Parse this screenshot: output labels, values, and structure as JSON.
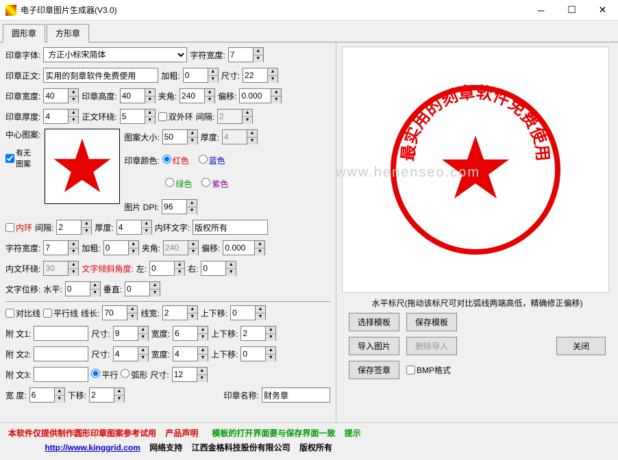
{
  "title": "电子印章图片生成器(V3.0)",
  "tabs": {
    "round": "圆形章",
    "square": "方形章"
  },
  "font": {
    "label": "印章字体:",
    "value": "方正小标宋简体",
    "charwidth_label": "字符宽度:",
    "charwidth": "7"
  },
  "text": {
    "label": "印章正文:",
    "value": "实用的刻章软件免费使用",
    "bold_label": "加粗:",
    "bold": "0",
    "size_label": "尺寸:",
    "size": "22"
  },
  "dims": {
    "width_label": "印章宽度:",
    "width": "40",
    "height_label": "印章高度:",
    "height": "40",
    "angle_label": "夹角:",
    "angle": "240",
    "offset_label": "偏移:",
    "offset": "0.000"
  },
  "thick": {
    "label": "印章厚度:",
    "value": "4",
    "wrap_label": "正文环绕:",
    "wrap": "5",
    "dbl_outer": "双外环",
    "gap_label": "间隔:",
    "gap": "2"
  },
  "center": {
    "label": "中心图案:",
    "has_img": "有无\n图案",
    "pattern_size_label": "图案大小:",
    "pattern_size": "50",
    "thick_label": "厚度:",
    "thick": "4",
    "color_label": "印章颜色:",
    "red": "红色",
    "blue": "蓝色",
    "green": "绿色",
    "purple": "紫色",
    "dpi_label": "图片 DPI:",
    "dpi": "96"
  },
  "inner": {
    "ring": "内环",
    "gap_label": "间隔:",
    "gap": "2",
    "thick_label": "厚度:",
    "thick": "4",
    "text_label": "内环文字:",
    "text": "版权所有"
  },
  "inner_font": {
    "width_label": "字符宽度:",
    "width": "7",
    "bold_label": "加粗:",
    "bold": "0",
    "angle_label": "夹角:",
    "angle": "240",
    "offset_label": "偏移:",
    "offset": "0.000"
  },
  "inner_wrap": {
    "label": "内文环绕:",
    "value": "30",
    "tilt_label": "文字倾斜角度:",
    "left_label": "左:",
    "left": "0",
    "right_label": "右:",
    "right": "0"
  },
  "text_shift": {
    "label": "文字位移:",
    "h_label": "水平:",
    "h": "0",
    "v_label": "垂直:",
    "v": "0"
  },
  "lines": {
    "contrast": "对比线",
    "parallel": "平行线",
    "len_label": "线长:",
    "len": "70",
    "width_label": "线宽:",
    "width": "2",
    "updown_label": "上下移:",
    "updown": "0"
  },
  "att1": {
    "label": "附  文1:",
    "value": "",
    "size_label": "尺寸:",
    "size": "9",
    "width_label": "宽度:",
    "width": "6",
    "updown_label": "上下移:",
    "updown": "2"
  },
  "att2": {
    "label": "附  文2:",
    "value": "",
    "size_label": "尺寸:",
    "size": "4",
    "width_label": "宽度:",
    "width": "4",
    "updown_label": "上下移:",
    "updown": "0"
  },
  "att3": {
    "label": "附  文3:",
    "value": "",
    "parallel": "平行",
    "arc": "弧形",
    "size_label": "尺寸:",
    "size": "12"
  },
  "bottom": {
    "width_label": "宽    度:",
    "width": "6",
    "down_label": "下移:",
    "down": "2",
    "name_label": "印章名称:",
    "name": "财务章"
  },
  "ruler_hint": "水平标尺(拖动该标尺可对比弧线两端高低，精确修正偏移)",
  "btns": {
    "choose_tpl": "选择模板",
    "save_tpl": "保存模板",
    "import_img": "导入图片",
    "del_import": "删除导入",
    "close": "关闭",
    "save_sig": "保存签章",
    "bmp": "BMP格式"
  },
  "footer": {
    "l1a": "本软件仅提供制作圆形印章图案参考试用",
    "l1b": "产品声明",
    "l1c": "模板的打开界面要与保存界面一致",
    "l1d": "提示",
    "l2a": "http://www.kinggrid.com",
    "l2b": "网络支持",
    "l2c": "江西金格科技股份有限公司",
    "l2d": "版权所有"
  },
  "seal_text": "最实用的刻章软件免费使用",
  "watermark": "www.henenseo.com"
}
